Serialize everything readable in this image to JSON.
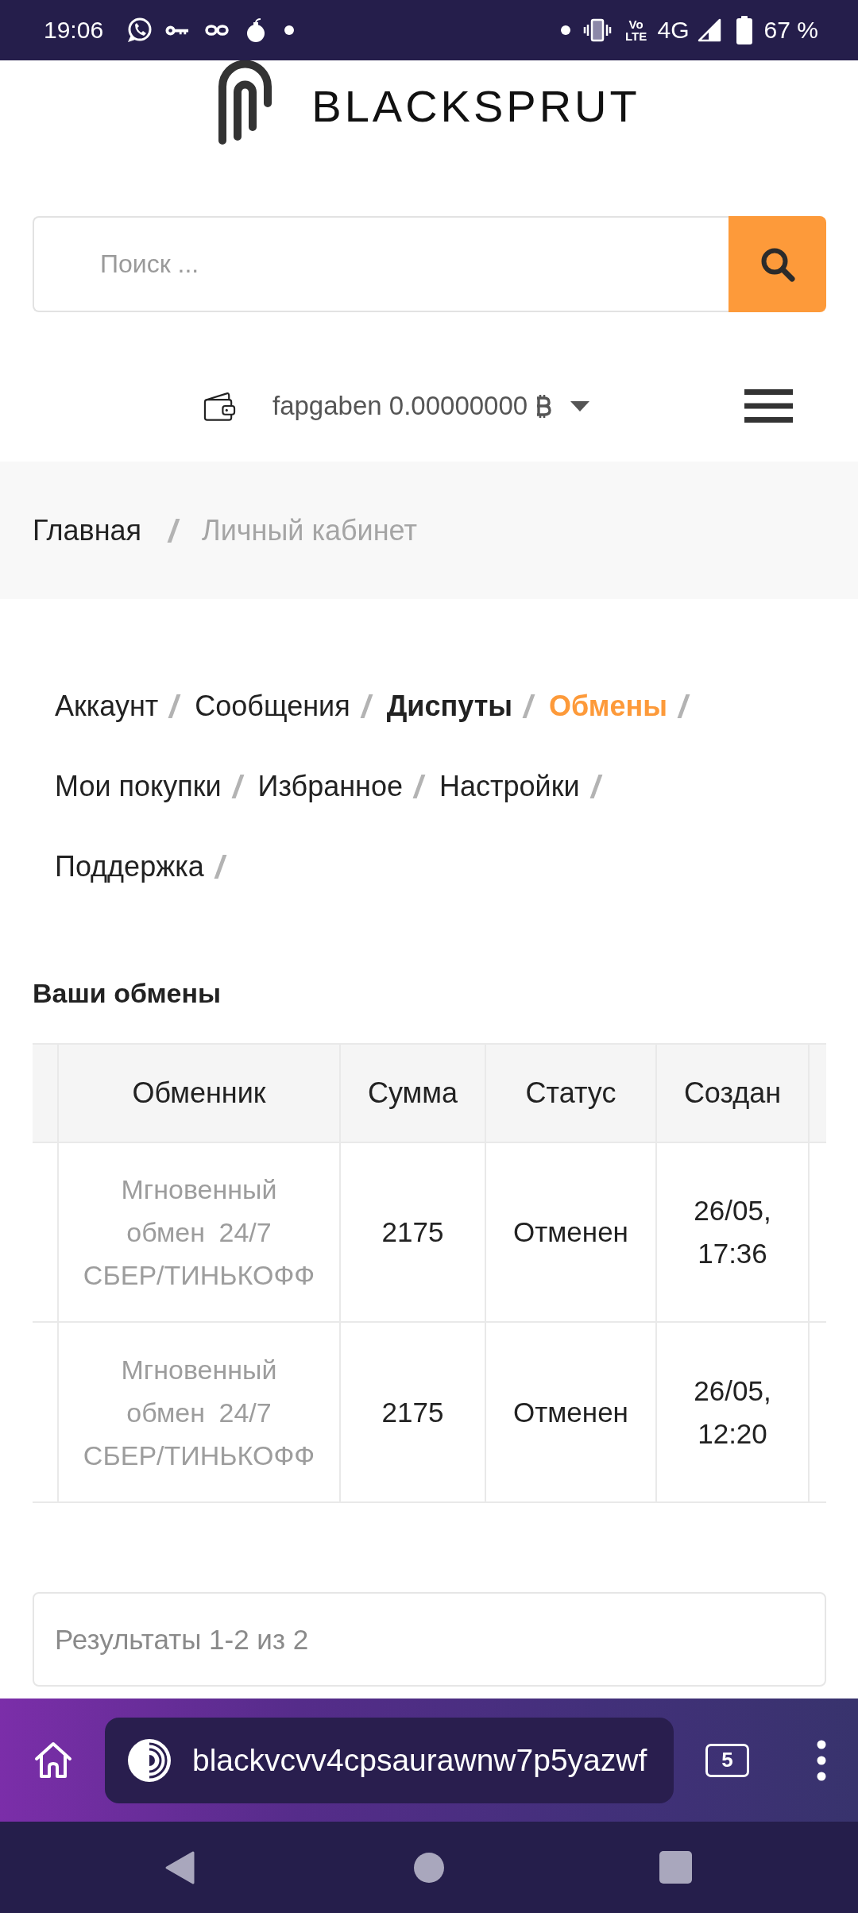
{
  "status_bar": {
    "time": "19:06",
    "volte": "Vo LTE",
    "network": "4G",
    "battery": "67 %"
  },
  "logo": {
    "text": "BLACKSPRUT"
  },
  "search": {
    "placeholder": "Поиск ..."
  },
  "account": {
    "label": "fapgaben 0.00000000"
  },
  "breadcrumbs": [
    {
      "label": "Главная",
      "current": false
    },
    {
      "label": "Личный кабинет",
      "current": true
    }
  ],
  "account_nav": [
    {
      "label": "Аккаунт",
      "selected": false,
      "emphasized": false
    },
    {
      "label": "Сообщения",
      "selected": false,
      "emphasized": false
    },
    {
      "label": "Диспуты",
      "selected": false,
      "emphasized": true
    },
    {
      "label": "Обмены",
      "selected": true,
      "emphasized": false
    },
    {
      "label": "Мои покупки",
      "selected": false,
      "emphasized": false
    },
    {
      "label": "Избранное",
      "selected": false,
      "emphasized": false
    },
    {
      "label": "Настройки",
      "selected": false,
      "emphasized": false
    },
    {
      "label": "Поддержка",
      "selected": false,
      "emphasized": false
    }
  ],
  "section_title": "Ваши обмены",
  "table": {
    "columns": [
      "Обменник",
      "Сумма",
      "Статус",
      "Создан"
    ],
    "rows": [
      [
        "Мгновенный обмен 24/7 СБЕР/ТИНЬКОФФ",
        "2175",
        "Отменен",
        "26/05, 17:36"
      ],
      [
        "Мгновенный обмен 24/7 СБЕР/ТИНЬКОФФ",
        "2175",
        "Отменен",
        "26/05, 12:20"
      ]
    ]
  },
  "results_summary": "Результаты 1-2 из 2",
  "browser": {
    "url": "blackvcvv4cpsaurawnw7p5yazwf",
    "tab_count": "5"
  }
}
